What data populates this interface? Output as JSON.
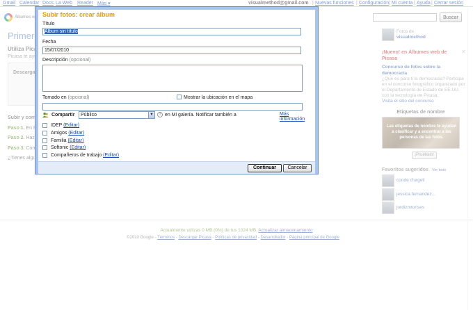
{
  "topbar": {
    "gmail": "Gmail",
    "calendar": "Calendar",
    "docs": "Docs",
    "web": "La Web",
    "reader": "Reader",
    "more": "Más ▾",
    "email": "visualmethod@gmail.com",
    "new_features": "Nuevas funciones",
    "settings": "Configuración",
    "account": "Mi cuenta",
    "help": "Ayuda",
    "signout": "Cerrar sesión"
  },
  "header": {
    "logo_text": "Álbumes w",
    "search_placeholder": "",
    "search_button": "Buscar"
  },
  "background": {
    "title": "Primeros",
    "subtitle": "Utiliza Pica",
    "subtitle2": "Picasa te ayu",
    "box_label": "Descargar",
    "steps_header": "Subir y comp",
    "step1_label": "Paso 1.",
    "step1_text": "En P",
    "step2_label": "Paso 2.",
    "step2_text": "Haz c",
    "step3_label": "Paso 3.",
    "step3_text": "Com",
    "question": "¿Tienes algu"
  },
  "sidebar": {
    "photos_of": "Fotos de",
    "username": "visualmethod",
    "news_title": "¡Nuevo! en Álbumes web de Picasa",
    "contest_title": "Concurso de fotos sobre la democracia",
    "contest_desc": "¿Qué es para ti la democracia? Participa en el concurso fotográfico organizado por el Departamento de Estado de EE.UU. con la tecnología de Picasa.",
    "contest_link": "Visita el sitio del concurso",
    "name_tags_title": "Etiquetas de nombre",
    "faces_text": "Las etiquetas de nombre te ayudan a clasificar y a encontrar a las personas de las fotos.",
    "try_button": "¡Pruébalo!",
    "suggested_title": "Favoritos sugeridos",
    "view_all": "Ver todo",
    "suggested": [
      {
        "name": "conde d'urgell"
      },
      {
        "name": "jessica.fernandez..."
      },
      {
        "name": "jordizmtorises"
      }
    ]
  },
  "footer": {
    "usage": "Actualmente utilizas 0 MB (0%) de tus 1024 MB.",
    "upgrade": "Actualizar almacenamiento",
    "copyright": "©2010 Google",
    "links": [
      "Términos",
      "Descargar Picasa",
      "Políticas de privacidad",
      "Desarrollador",
      "Página principal de Google"
    ]
  },
  "dialog": {
    "title": "Subir fotos: crear álbum",
    "title_label": "Título",
    "title_value": "Álbum sin título",
    "date_label": "Fecha",
    "date_value": "15/07/2010",
    "description_label": "Descripción",
    "optional": "(opcional)",
    "taken_in_label": "Tomado en",
    "show_map_label": "Mostrar la ubicación en el mapa",
    "share_label": "Compartir",
    "share_value": "Público",
    "notify_text": "en Mi galería. Notificar también a",
    "more_info": "Más información",
    "groups": [
      {
        "name": "IDEP",
        "edit": "(Editar)"
      },
      {
        "name": "Amigos",
        "edit": "(Editar)"
      },
      {
        "name": "Familia",
        "edit": "(Editar)"
      },
      {
        "name": "Softonic",
        "edit": "(Editar)"
      },
      {
        "name": "Compañeros de trabajo",
        "edit": "(Editar)"
      }
    ],
    "continue_button": "Continuar",
    "cancel_button": "Cancelar"
  },
  "colors": {
    "dialog_title": "#f39a00",
    "link": "#1a4bb4",
    "dialog_border": "#a9c3ef",
    "selection": "#3162b9"
  }
}
